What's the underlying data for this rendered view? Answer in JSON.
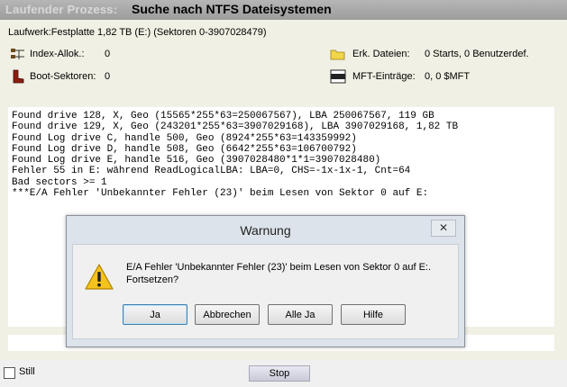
{
  "titlebar": {
    "prefix": "Laufender Prozess:",
    "title": "Suche nach NTFS Dateisystemen"
  },
  "drive_info": "Laufwerk:Festplatte 1,82 TB (E:) (Sektoren 0-3907028479)",
  "stats": {
    "index_label": "Index-Allok.:",
    "index_value": "0",
    "boot_label": "Boot-Sektoren:",
    "boot_value": "0",
    "files_label": "Erk. Dateien:",
    "files_value": "0 Starts, 0 Benutzerdef.",
    "mft_label": "MFT-Einträge:",
    "mft_value": "0, 0 $MFT"
  },
  "log_lines": [
    "Found drive 128, X, Geo (15565*255*63=250067567), LBA 250067567, 119 GB",
    "Found drive 129, X, Geo (243201*255*63=3907029168), LBA 3907029168, 1,82 TB",
    "Found Log drive C, handle 500, Geo (8924*255*63=143359992)",
    "Found Log drive D, handle 508, Geo (6642*255*63=106700792)",
    "Found Log drive E, handle 516, Geo (3907028480*1*1=3907028480)",
    "Fehler 55 in E: während ReadLogicalLBA: LBA=0, CHS=-1x-1x-1, Cnt=64",
    "Bad sectors >= 1",
    "***E/A Fehler 'Unbekannter Fehler (23)' beim Lesen von Sektor 0 auf E:"
  ],
  "bottom": {
    "still_label": "Still",
    "stop_label": "Stop"
  },
  "dialog": {
    "title": "Warnung",
    "close_label": "✕",
    "message_line1": "E/A Fehler 'Unbekannter Fehler (23)' beim Lesen von Sektor 0 auf E:.",
    "message_line2": "Fortsetzen?",
    "buttons": {
      "yes": "Ja",
      "abort": "Abbrechen",
      "yes_all": "Alle Ja",
      "help": "Hilfe"
    }
  }
}
